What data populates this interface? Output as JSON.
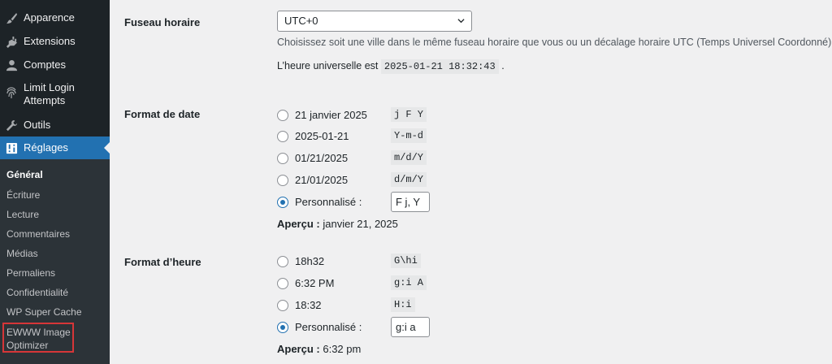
{
  "sidebar": {
    "menu": [
      {
        "label": "Apparence",
        "icon": "paintbrush-icon"
      },
      {
        "label": "Extensions",
        "icon": "plugin-icon"
      },
      {
        "label": "Comptes",
        "icon": "user-icon"
      },
      {
        "label": "Limit Login",
        "label2": "Attempts",
        "icon": "fingerprint-icon"
      },
      {
        "label": "Outils",
        "icon": "wrench-icon"
      },
      {
        "label": "Réglages",
        "icon": "settings-icon",
        "active": true
      }
    ],
    "submenu": [
      {
        "label": "Général",
        "current": true
      },
      {
        "label": "Écriture"
      },
      {
        "label": "Lecture"
      },
      {
        "label": "Commentaires"
      },
      {
        "label": "Médias"
      },
      {
        "label": "Permaliens"
      },
      {
        "label": "Confidentialité"
      },
      {
        "label": "WP Super Cache"
      },
      {
        "label": "EWWW Image",
        "label2": "Optimizer",
        "highlighted": true
      }
    ]
  },
  "timezone": {
    "label": "Fuseau horaire",
    "selected": "UTC+0",
    "description": "Choisissez soit une ville dans le même fuseau horaire que vous ou un décalage horaire UTC (Temps Universel Coordonné).",
    "utc_prefix": "L’heure universelle est",
    "utc_value": "2025-01-21 18:32:43",
    "utc_suffix": "."
  },
  "date_format": {
    "label": "Format de date",
    "options": [
      {
        "label": "21 janvier 2025",
        "code": "j F Y"
      },
      {
        "label": "2025-01-21",
        "code": "Y-m-d"
      },
      {
        "label": "01/21/2025",
        "code": "m/d/Y"
      },
      {
        "label": "21/01/2025",
        "code": "d/m/Y"
      }
    ],
    "custom_label": "Personnalisé :",
    "custom_value": "F j, Y",
    "preview_label": "Aperçu :",
    "preview_value": "janvier 21, 2025"
  },
  "time_format": {
    "label": "Format d’heure",
    "options": [
      {
        "label": "18h32",
        "code": "G\\hi"
      },
      {
        "label": "6:32 PM",
        "code": "g:i A"
      },
      {
        "label": "18:32",
        "code": "H:i"
      }
    ],
    "custom_label": "Personnalisé :",
    "custom_value": "g:i a",
    "preview_label": "Aperçu :",
    "preview_value": "6:32 pm"
  },
  "colors": {
    "sidebar_bg": "#1d2327",
    "submenu_bg": "#2c3338",
    "accent": "#2271b1",
    "highlight_border": "#d63638"
  }
}
